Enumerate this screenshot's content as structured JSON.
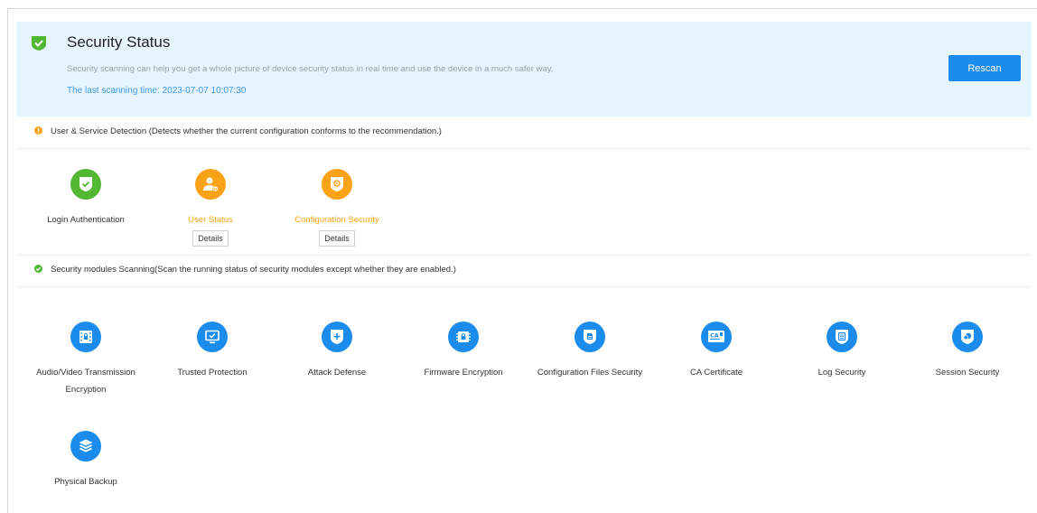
{
  "header": {
    "title": "Security Status",
    "description": "Security scanning can help you get a whole picture of device security status in real time and use the device in a much safer way.",
    "last_scan": "The last scanning time: 2023-07-07 10:07:30",
    "rescan_label": "Rescan"
  },
  "user_service": {
    "heading": "User & Service Detection (Detects whether the current configuration conforms to the recommendation.)",
    "items": [
      {
        "label": "Login Authentication",
        "icon": "shield-check-icon",
        "status": "ok"
      },
      {
        "label": "User Status",
        "icon": "user-icon",
        "status": "warning",
        "details_label": "Details"
      },
      {
        "label": "Configuration Security",
        "icon": "config-shield-icon",
        "status": "warning",
        "details_label": "Details"
      }
    ]
  },
  "modules": {
    "heading": "Security modules Scanning(Scan the running status of security modules except whether they are enabled.)",
    "items": [
      {
        "label": "Audio/Video Transmission Encryption",
        "icon": "av-lock-icon"
      },
      {
        "label": "Trusted Protection",
        "icon": "monitor-check-icon"
      },
      {
        "label": "Attack Defense",
        "icon": "shield-plus-icon"
      },
      {
        "label": "Firmware Encryption",
        "icon": "chip-lock-icon"
      },
      {
        "label": "Configuration Files Security",
        "icon": "file-shield-icon"
      },
      {
        "label": "CA Certificate",
        "icon": "certificate-icon"
      },
      {
        "label": "Log Security",
        "icon": "log-shield-icon"
      },
      {
        "label": "Session Security",
        "icon": "session-shield-icon"
      },
      {
        "label": "Physical Backup",
        "icon": "layers-icon"
      }
    ]
  },
  "colors": {
    "ok": "#52b733",
    "warning": "#faa319",
    "accent": "#1b8ceb",
    "banner_bg": "#e6f4fd"
  }
}
